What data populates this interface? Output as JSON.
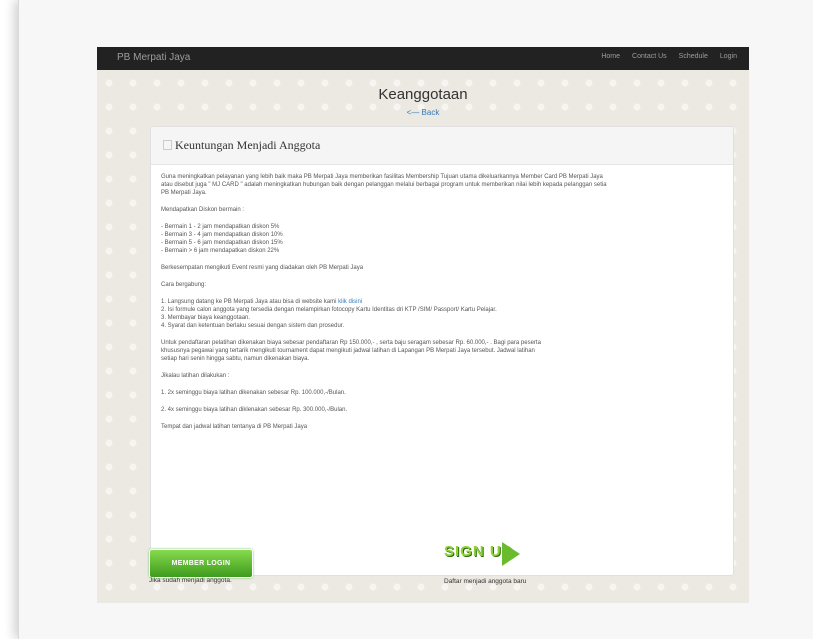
{
  "navbar": {
    "brand": "PB Merpati Jaya",
    "links": [
      "Home",
      "Contact Us",
      "Schedule",
      "Login"
    ]
  },
  "header": {
    "title": "Keanggotaan",
    "back_label": "<— Back"
  },
  "panel": {
    "title": "Keuntungan Menjadi Anggota",
    "intro": [
      "Guna meningkatkan pelayanan yang lebih baik maka PB Merpati Jaya memberikan fasilitas Membership Tujuan utama dikeluarkannya Member Card PB Merpati Jaya",
      "atau disebut juga \" MJ CARD \" adalah meningkatkan hubungan baik dengan pelanggan melalui berbagai program untuk memberikan nilai lebih kepada pelanggan setia",
      "PB Merpati Jaya."
    ],
    "discount_heading": "Mendapatkan Diskon bermain :",
    "discounts": [
      "- Bermain 1 - 2 jam mendapatkan diskon 5%",
      "- Bermain 3 - 4 jam mendapatkan diskon 10%",
      "- Bermain 5 - 6 jam mendapatkan diskon 15%",
      "- Bermain > 6 jam mendapatkan diskon 22%"
    ],
    "event_text": "Berkesempatan mengikuti Event resmi yang diadakan oleh PB Merpati Jaya",
    "join_heading": "Cara bergabung:",
    "join_step1": "1. Langsung datang ke PB Merpati Jaya atau bisa di website kami",
    "join_step1_link": "klik disini",
    "join_steps": [
      "2. Isi formule calon anggota yang tersedia dengan melampirkan fotocopy Kartu Identitas dri KTP /SIM/ Passport/ Kartu Pelajar.",
      "3. Membayar biaya keanggotaan.",
      "4. Syarat dan ketentuan berlaku sesuai dengan sistem dan prosedur."
    ],
    "training_text": [
      "Untuk pendaftaran pelatihan dikenakan biaya sebesar pendaftaran Rp 150.000,- , serta baju seragam sebesar Rp. 60.000,- . Bagi para peserta",
      "khususnya pegawai yang tertarik mengikuti tournament dapat mengikuti jadwal latihan di Lapangan PB Merpati Jaya tersebut. Jadwal latihan",
      "setiap hari senin hingga sabtu, namun dikenakan biaya."
    ],
    "schedule_heading": "Jikalau latihan dilakukan :",
    "schedule_items": [
      "1. 2x seminggu biaya latihan dikenakan sebesar Rp. 100.000,-/Bulan.",
      "2. 4x seminggu biaya latihan diklenakan sebesar Rp. 300.000,-/Bulan."
    ],
    "place_text": "Tempat dan jadwal latihan tentanya di PB Merpati Jaya"
  },
  "actions": {
    "member_login_label": "MEMBER LOGIN",
    "member_caption": "Jika sudah menjadi anggota.",
    "signup_label": "SIGN UP",
    "signup_caption": "Daftar menjadi anggota baru"
  }
}
